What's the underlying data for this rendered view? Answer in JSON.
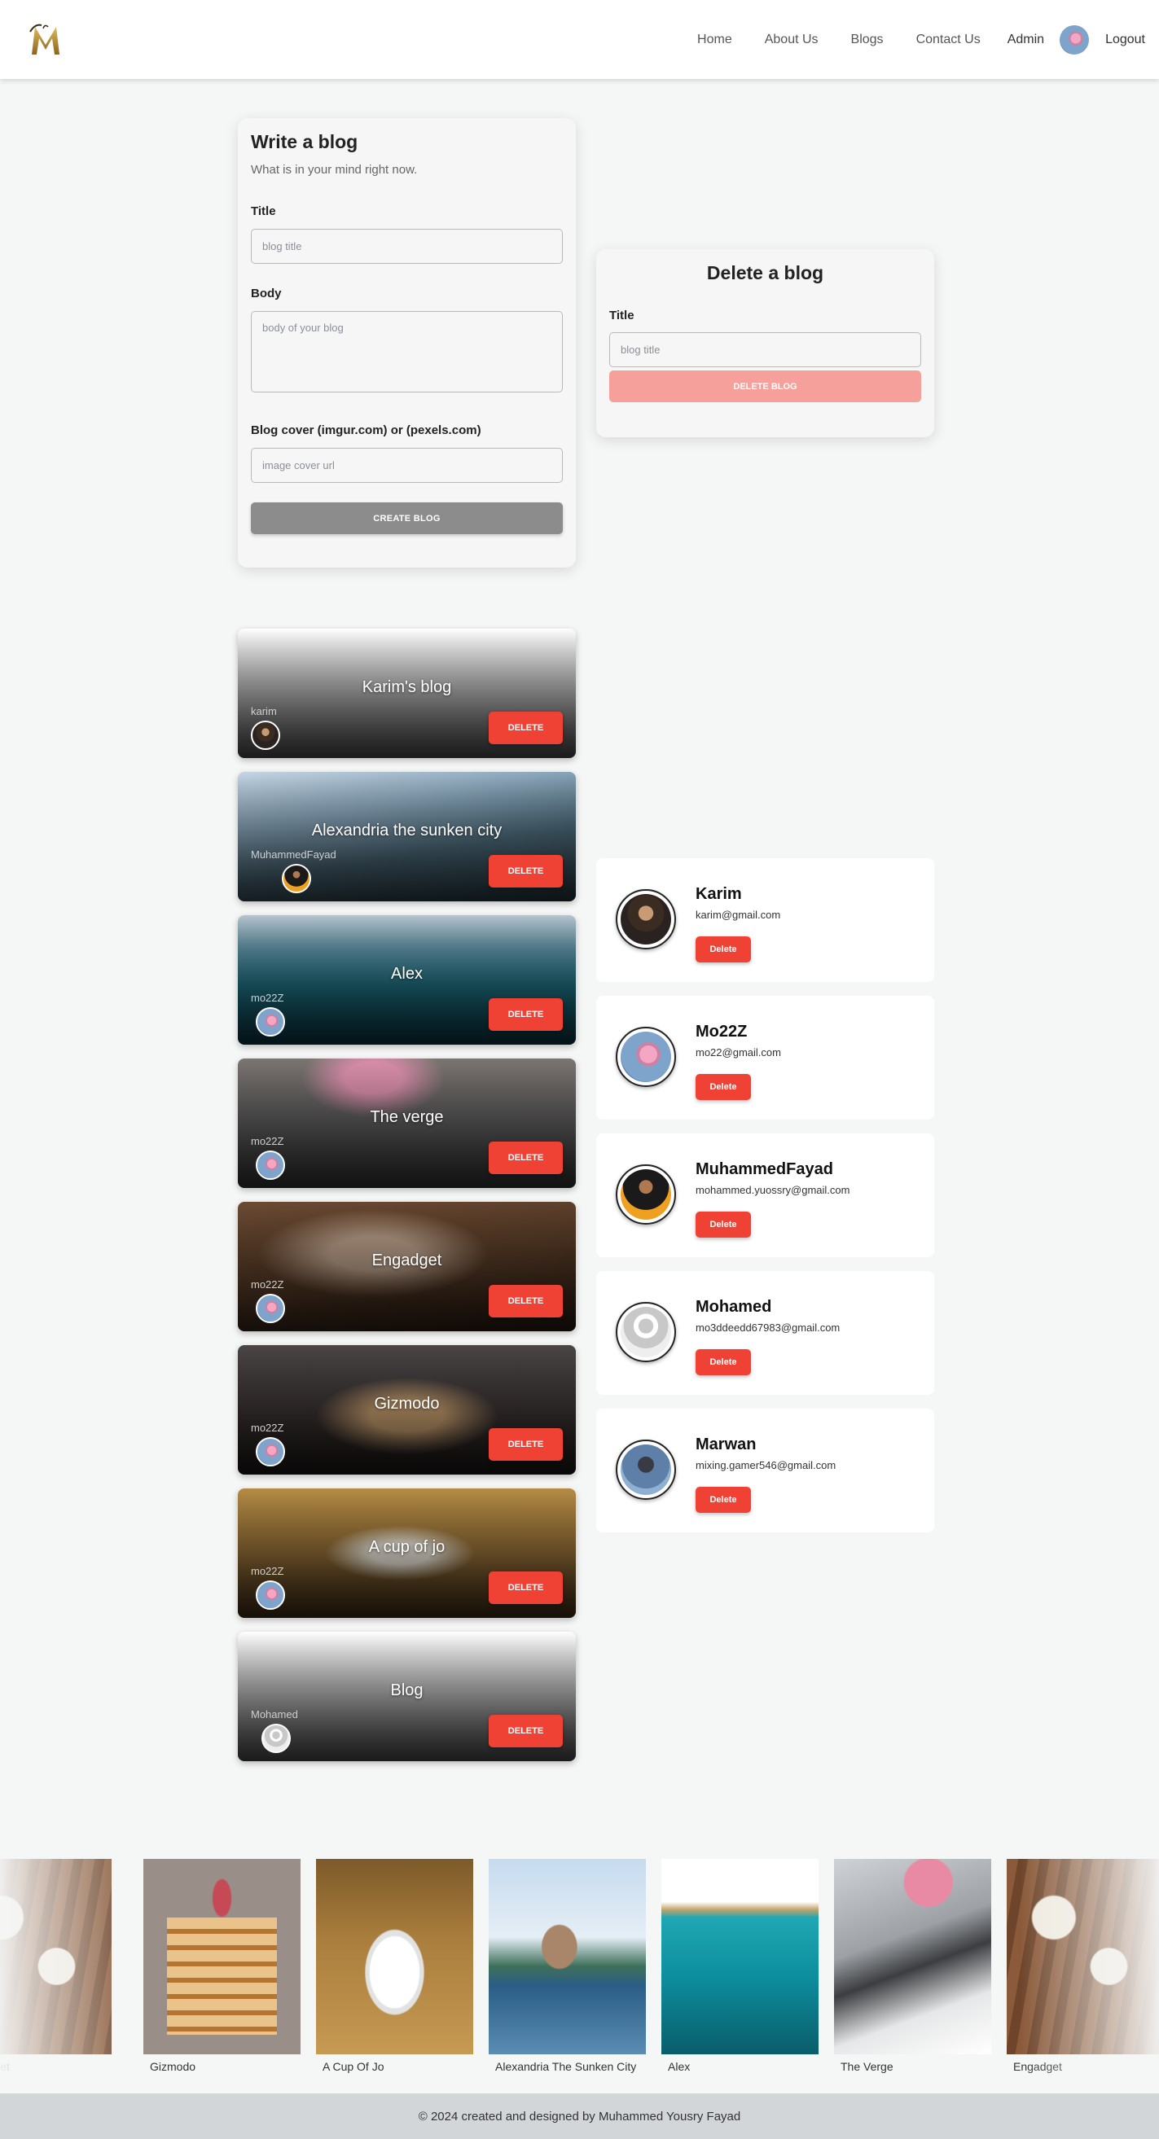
{
  "nav": {
    "logo": "M",
    "links": [
      "Home",
      "About Us",
      "Blogs",
      "Contact Us"
    ],
    "admin": "Admin",
    "logout": "Logout"
  },
  "write_form": {
    "title": "Write a blog",
    "subtitle": "What is in your mind right now.",
    "title_label": "Title",
    "title_placeholder": "blog title",
    "body_label": "Body",
    "body_placeholder": "body of your blog",
    "cover_label": "Blog cover (imgur.com) or (pexels.com)",
    "cover_placeholder": "image cover url",
    "submit_label": "CREATE BLOG"
  },
  "delete_form": {
    "title": "Delete a blog",
    "title_label": "Title",
    "title_placeholder": "blog title",
    "submit_label": "DELETE BLOG"
  },
  "blogs": [
    {
      "title": "Karim's blog",
      "author": "karim",
      "bg": "bg-gray",
      "avatar": "av-karim",
      "delete_label": "DELETE"
    },
    {
      "title": "Alexandria the sunken city",
      "author": "MuhammedFayad",
      "bg": "bg-alex",
      "avatar": "av-fayad",
      "delete_label": "DELETE"
    },
    {
      "title": "Alex",
      "author": "mo22Z",
      "bg": "bg-sea",
      "avatar": "av-mo22z",
      "delete_label": "DELETE"
    },
    {
      "title": "The verge",
      "author": "mo22Z",
      "bg": "bg-verge",
      "avatar": "av-mo22z",
      "delete_label": "DELETE"
    },
    {
      "title": "Engadget",
      "author": "mo22Z",
      "bg": "bg-engad",
      "avatar": "av-mo22z",
      "delete_label": "DELETE"
    },
    {
      "title": "Gizmodo",
      "author": "mo22Z",
      "bg": "bg-gizmo",
      "avatar": "av-mo22z",
      "delete_label": "DELETE"
    },
    {
      "title": "A cup of jo",
      "author": "mo22Z",
      "bg": "bg-cup",
      "avatar": "av-mo22z",
      "delete_label": "DELETE"
    },
    {
      "title": "Blog",
      "author": "Mohamed",
      "bg": "bg-gray",
      "avatar": "av-default",
      "delete_label": "DELETE"
    }
  ],
  "users": [
    {
      "name": "Karim",
      "email": "karim@gmail.com",
      "avatar": "av-karim",
      "delete_label": "Delete"
    },
    {
      "name": "Mo22Z",
      "email": "mo22@gmail.com",
      "avatar": "av-mo22z",
      "delete_label": "Delete"
    },
    {
      "name": "MuhammedFayad",
      "email": "mohammed.yuossry@gmail.com",
      "avatar": "av-fayad",
      "delete_label": "Delete"
    },
    {
      "name": "Mohamed",
      "email": "mo3ddeedd67983@gmail.com",
      "avatar": "av-default",
      "delete_label": "Delete"
    },
    {
      "name": "Marwan",
      "email": "mixing.gamer546@gmail.com",
      "avatar": "av-marwan",
      "delete_label": "Delete"
    }
  ],
  "carousel": [
    {
      "caption": "Engadget",
      "img": "img-engadget"
    },
    {
      "caption": "Gizmodo",
      "img": "img-gizmodo"
    },
    {
      "caption": "A Cup Of Jo",
      "img": "img-cup"
    },
    {
      "caption": "Alexandria The Sunken City",
      "img": "img-alex"
    },
    {
      "caption": "Alex",
      "img": "img-sea"
    },
    {
      "caption": "The Verge",
      "img": "img-verge"
    },
    {
      "caption": "Engadget",
      "img": "img-engadget"
    }
  ],
  "footer": {
    "text": "© 2024 created and designed by Muhammed Yousry Fayad"
  },
  "colors": {
    "accent_red": "#ef4234",
    "disabled_red": "#f5a09a",
    "disabled_gray": "#8c8c8c",
    "footer_bg": "#d3d6d8"
  }
}
